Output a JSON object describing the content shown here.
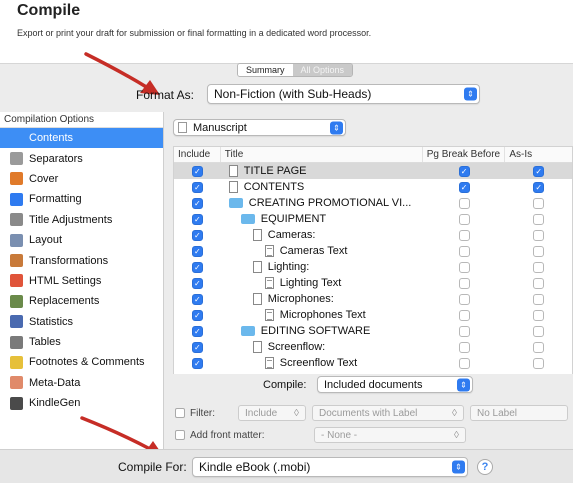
{
  "header": {
    "title": "Compile",
    "subtitle": "Export or print your draft for submission or final formatting in a dedicated word processor."
  },
  "tabs": {
    "summary": "Summary",
    "all_options": "All Options"
  },
  "format_as": {
    "label": "Format As:",
    "value": "Non-Fiction (with Sub-Heads)"
  },
  "sidebar": {
    "header": "Compilation Options",
    "items": [
      {
        "label": "Contents",
        "icon": "contents-icon",
        "color": "#3d8ef5",
        "selected": true
      },
      {
        "label": "Separators",
        "icon": "separators-icon",
        "color": "#9a9a9a"
      },
      {
        "label": "Cover",
        "icon": "cover-icon",
        "color": "#e07a2a"
      },
      {
        "label": "Formatting",
        "icon": "formatting-icon",
        "color": "#2f7bf0"
      },
      {
        "label": "Title Adjustments",
        "icon": "title-adjustments-icon",
        "color": "#8a8a8a"
      },
      {
        "label": "Layout",
        "icon": "layout-icon",
        "color": "#7a8fb0"
      },
      {
        "label": "Transformations",
        "icon": "transformations-icon",
        "color": "#c87a3a"
      },
      {
        "label": "HTML Settings",
        "icon": "html-settings-icon",
        "color": "#e0543a"
      },
      {
        "label": "Replacements",
        "icon": "replacements-icon",
        "color": "#6a8a4a"
      },
      {
        "label": "Statistics",
        "icon": "statistics-icon",
        "color": "#4a6ab0"
      },
      {
        "label": "Tables",
        "icon": "tables-icon",
        "color": "#7a7a7a"
      },
      {
        "label": "Footnotes & Comments",
        "icon": "footnotes-icon",
        "color": "#e6c03a"
      },
      {
        "label": "Meta-Data",
        "icon": "meta-data-icon",
        "color": "#e08a6a"
      },
      {
        "label": "KindleGen",
        "icon": "kindlegen-icon",
        "color": "#4a4a4a"
      }
    ]
  },
  "content": {
    "group_popup": "Manuscript",
    "columns": {
      "include": "Include",
      "title": "Title",
      "pg_break": "Pg Break Before",
      "as_is": "As-Is"
    },
    "rows": [
      {
        "title": "TITLE PAGE",
        "indent": 1,
        "icon": "document-icon",
        "include": true,
        "pg": true,
        "asis": true,
        "selected": true
      },
      {
        "title": "CONTENTS",
        "indent": 1,
        "icon": "document-icon",
        "include": true,
        "pg": true,
        "asis": true
      },
      {
        "title": "CREATING PROMOTIONAL VI...",
        "indent": 1,
        "icon": "folder-icon",
        "include": true,
        "pg": false,
        "asis": false
      },
      {
        "title": "EQUIPMENT",
        "indent": 2,
        "icon": "folder-icon",
        "include": true,
        "pg": false,
        "asis": false
      },
      {
        "title": "Cameras:",
        "indent": 3,
        "icon": "document-icon",
        "include": true,
        "pg": false,
        "asis": false
      },
      {
        "title": "Cameras Text",
        "indent": 4,
        "icon": "text-document-icon",
        "include": true,
        "pg": false,
        "asis": false
      },
      {
        "title": "Lighting:",
        "indent": 3,
        "icon": "document-icon",
        "include": true,
        "pg": false,
        "asis": false
      },
      {
        "title": "Lighting Text",
        "indent": 4,
        "icon": "text-document-icon",
        "include": true,
        "pg": false,
        "asis": false
      },
      {
        "title": "Microphones:",
        "indent": 3,
        "icon": "document-icon",
        "include": true,
        "pg": false,
        "asis": false
      },
      {
        "title": "Microphones Text",
        "indent": 4,
        "icon": "text-document-icon",
        "include": true,
        "pg": false,
        "asis": false
      },
      {
        "title": "EDITING SOFTWARE",
        "indent": 2,
        "icon": "folder-icon",
        "include": true,
        "pg": false,
        "asis": false
      },
      {
        "title": "Screenflow:",
        "indent": 3,
        "icon": "document-icon",
        "include": true,
        "pg": false,
        "asis": false
      },
      {
        "title": "Screenflow Text",
        "indent": 4,
        "icon": "text-document-icon",
        "include": true,
        "pg": false,
        "asis": false
      }
    ],
    "compile": {
      "label": "Compile:",
      "value": "Included documents"
    },
    "filter": {
      "label": "Filter:",
      "mode": "Include",
      "criterion": "Documents with Label",
      "value": "No Label"
    },
    "front_matter": {
      "label": "Add front matter:",
      "value": "- None -"
    }
  },
  "footer": {
    "compile_for_label": "Compile For:",
    "compile_for_value": "Kindle eBook (.mobi)",
    "help": "?"
  },
  "colors": {
    "accent": "#2f7bf0",
    "selection": "#3d8ef5",
    "arrow": "#d0312d"
  }
}
